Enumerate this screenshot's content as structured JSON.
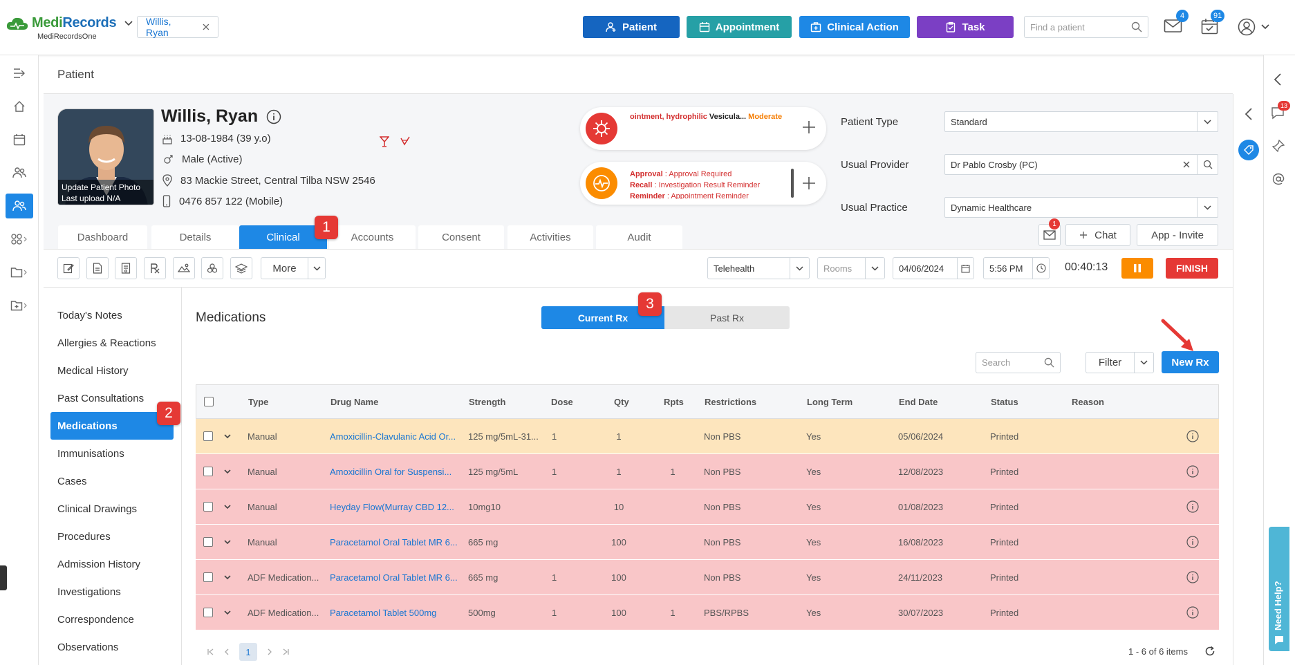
{
  "app": {
    "logo_medi": "Medi",
    "logo_records": "Records",
    "logo_sub": "MediRecordsOne"
  },
  "topbar": {
    "patient_chip": "Willis, Ryan",
    "buttons": [
      {
        "label": "Patient",
        "color": "#1565c0"
      },
      {
        "label": "Appointment",
        "color": "#26a0a6"
      },
      {
        "label": "Clinical Action",
        "color": "#1e88e5"
      },
      {
        "label": "Task",
        "color": "#7b3fc4"
      }
    ],
    "search_placeholder": "Find a patient",
    "mail_count": "4",
    "tasks_count": "91"
  },
  "page": {
    "title": "Patient"
  },
  "patient": {
    "name": "Willis, Ryan",
    "dob": "13-08-1984 (39 y.o)",
    "gender": "Male (Active)",
    "address": "83 Mackie Street, Central Tilba NSW 2546",
    "phone": "0476 857 122 (Mobile)",
    "photo_line1": "Update Patient Photo",
    "photo_line2": "Last upload N/A"
  },
  "alerts": {
    "allergy_red": "ointment, hydrophilic",
    "allergy_black": "Vesicula...",
    "allergy_severity": "Moderate",
    "reminders": [
      {
        "key": "Approval",
        "value": ": Approval Required"
      },
      {
        "key": "Recall",
        "value": ": Investigation Result Reminder"
      },
      {
        "key": "Reminder",
        "value": ": Appointment Reminder"
      }
    ]
  },
  "fields": {
    "patient_type_label": "Patient Type",
    "patient_type_value": "Standard",
    "usual_provider_label": "Usual Provider",
    "usual_provider_value": "Dr Pablo Crosby (PC)",
    "usual_practice_label": "Usual Practice",
    "usual_practice_value": "Dynamic Healthcare",
    "msg_count": "1",
    "chat_label": "Chat",
    "app_invite_label": "App - Invite"
  },
  "tabs": [
    "Dashboard",
    "Details",
    "Clinical",
    "Accounts",
    "Consent",
    "Activities",
    "Audit"
  ],
  "steps": [
    "1",
    "2",
    "3"
  ],
  "toolbar": {
    "more_label": "More",
    "visit_type": "Telehealth",
    "rooms_placeholder": "Rooms",
    "date": "04/06/2024",
    "time": "5:56 PM",
    "timer": "00:40:13",
    "finish_label": "FINISH"
  },
  "sidenav": [
    "Today's Notes",
    "Allergies & Reactions",
    "Medical History",
    "Past Consultations",
    "Medications",
    "Immunisations",
    "Cases",
    "Clinical Drawings",
    "Procedures",
    "Admission History",
    "Investigations",
    "Correspondence",
    "Observations"
  ],
  "medications": {
    "title": "Medications",
    "seg_current": "Current Rx",
    "seg_past": "Past Rx",
    "search_placeholder": "Search",
    "filter_label": "Filter",
    "new_rx_label": "New Rx",
    "columns": [
      "Type",
      "Drug Name",
      "Strength",
      "Dose",
      "Qty",
      "Rpts",
      "Restrictions",
      "Long Term",
      "End Date",
      "Status",
      "Reason"
    ],
    "rows": [
      {
        "type": "Manual",
        "drug": "Amoxicillin-Clavulanic Acid Or...",
        "strength": "125 mg/5mL-31...",
        "dose": "1",
        "qty": "1",
        "rpts": "",
        "restrictions": "Non PBS",
        "long_term": "Yes",
        "end_date": "05/06/2024",
        "status": "Printed",
        "reason": ""
      },
      {
        "type": "Manual",
        "drug": "Amoxicillin Oral for Suspensi...",
        "strength": "125 mg/5mL",
        "dose": "1",
        "qty": "1",
        "rpts": "1",
        "restrictions": "Non PBS",
        "long_term": "Yes",
        "end_date": "12/08/2023",
        "status": "Printed",
        "reason": ""
      },
      {
        "type": "Manual",
        "drug": "Heyday Flow(Murray CBD 12...",
        "strength": "10mg10",
        "dose": "",
        "qty": "10",
        "rpts": "",
        "restrictions": "Non PBS",
        "long_term": "Yes",
        "end_date": "01/08/2023",
        "status": "Printed",
        "reason": ""
      },
      {
        "type": "Manual",
        "drug": "Paracetamol Oral Tablet MR 6...",
        "strength": "665 mg",
        "dose": "",
        "qty": "100",
        "rpts": "",
        "restrictions": "Non PBS",
        "long_term": "Yes",
        "end_date": "16/08/2023",
        "status": "Printed",
        "reason": ""
      },
      {
        "type": "ADF Medication...",
        "drug": "Paracetamol Oral Tablet MR 6...",
        "strength": "665 mg",
        "dose": "1",
        "qty": "100",
        "rpts": "",
        "restrictions": "Non PBS",
        "long_term": "Yes",
        "end_date": "24/11/2023",
        "status": "Printed",
        "reason": ""
      },
      {
        "type": "ADF Medication...",
        "drug": "Paracetamol Tablet 500mg",
        "strength": "500mg",
        "dose": "1",
        "qty": "100",
        "rpts": "1",
        "restrictions": "PBS/RPBS",
        "long_term": "Yes",
        "end_date": "30/07/2023",
        "status": "Printed",
        "reason": ""
      }
    ],
    "page_number": "1",
    "items_summary": "1 - 6 of 6 items"
  },
  "right_rail": {
    "chat_badge": "13",
    "need_help": "Need Help?"
  }
}
